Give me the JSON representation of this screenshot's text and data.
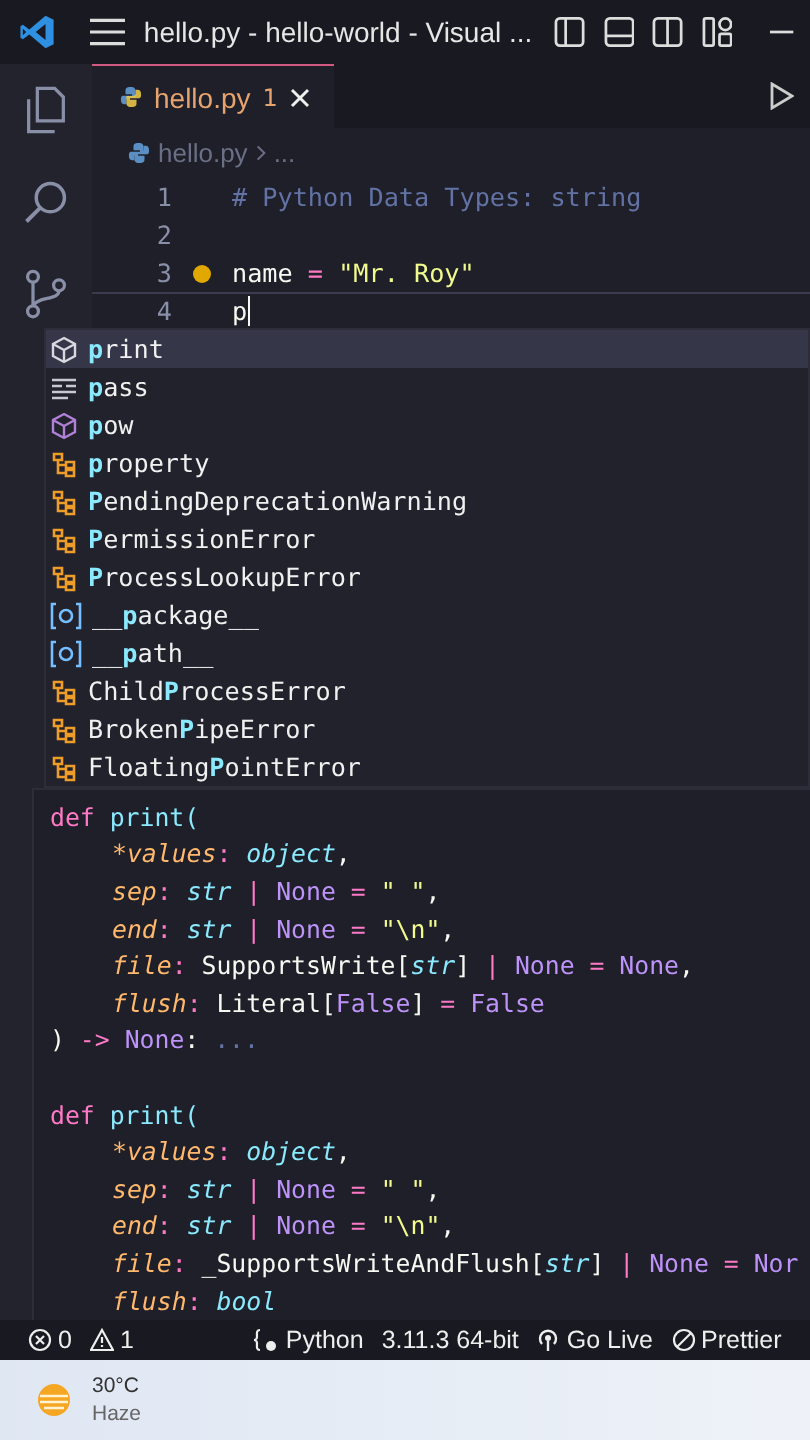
{
  "window": {
    "title": "hello.py - hello-world - Visual ..."
  },
  "tabs": [
    {
      "label": "hello.py",
      "problems": "1",
      "selected": true
    }
  ],
  "breadcrumb": {
    "file": "hello.py",
    "more": "..."
  },
  "editor": {
    "lines": [
      {
        "number": "1",
        "current": false,
        "tokens": [
          {
            "kind": "comment",
            "text": "# Python Data Types: string"
          }
        ]
      },
      {
        "number": "2",
        "current": false
      },
      {
        "number": "3",
        "current": false,
        "lightbulb": true,
        "tokens": [
          {
            "kind": "plain",
            "text": "name "
          },
          {
            "kind": "op",
            "text": "= "
          },
          {
            "kind": "string",
            "text": "\"Mr. Roy\""
          }
        ]
      },
      {
        "number": "4",
        "current": true,
        "tokens": [
          {
            "kind": "plain",
            "text": "p"
          }
        ]
      }
    ]
  },
  "suggestions": [
    {
      "kind": "method",
      "match": "p",
      "rest": "rint",
      "selected": true
    },
    {
      "kind": "keyword",
      "match": "p",
      "rest": "ass",
      "selected": false
    },
    {
      "kind": "function",
      "match": "p",
      "rest": "ow",
      "selected": false
    },
    {
      "kind": "class",
      "match": "p",
      "rest": "roperty",
      "selected": false
    },
    {
      "kind": "class",
      "match": "P",
      "rest": "endingDeprecationWarning",
      "selected": false
    },
    {
      "kind": "class",
      "match": "P",
      "rest": "ermissionError",
      "selected": false
    },
    {
      "kind": "class",
      "match": "P",
      "rest": "rocessLookupError",
      "selected": false
    },
    {
      "kind": "variable",
      "prefix": "__",
      "match": "p",
      "rest": "ackage__",
      "selected": false
    },
    {
      "kind": "variable",
      "prefix": "__",
      "match": "p",
      "rest": "ath__",
      "selected": false
    },
    {
      "kind": "class",
      "prefix": "Child",
      "match": "P",
      "rest": "rocessError",
      "selected": false
    },
    {
      "kind": "class",
      "prefix": "Broken",
      "match": "P",
      "rest": "ipeError",
      "selected": false
    },
    {
      "kind": "class",
      "prefix": "Floating",
      "match": "P",
      "rest": "ointError",
      "selected": false
    }
  ],
  "hover": {
    "lines": [
      {
        "kind": "code",
        "indent": false,
        "tokens": [
          {
            "kind": "keyword",
            "text": "def "
          },
          {
            "kind": "func",
            "text": "print("
          }
        ]
      },
      {
        "kind": "code",
        "indent": true,
        "tokens": [
          {
            "kind": "param",
            "text": "*values"
          },
          {
            "kind": "op",
            "text": ": "
          },
          {
            "kind": "type",
            "text": "object"
          },
          {
            "kind": "plain",
            "text": ","
          }
        ]
      },
      {
        "kind": "code",
        "indent": true,
        "tokens": [
          {
            "kind": "param",
            "text": "sep"
          },
          {
            "kind": "op",
            "text": ": "
          },
          {
            "kind": "type",
            "text": "str "
          },
          {
            "kind": "op",
            "text": "| "
          },
          {
            "kind": "const",
            "text": "None "
          },
          {
            "kind": "op",
            "text": "= "
          },
          {
            "kind": "string",
            "text": "\" \""
          },
          {
            "kind": "plain",
            "text": ","
          }
        ]
      },
      {
        "kind": "code",
        "indent": true,
        "tokens": [
          {
            "kind": "param",
            "text": "end"
          },
          {
            "kind": "op",
            "text": ": "
          },
          {
            "kind": "type",
            "text": "str "
          },
          {
            "kind": "op",
            "text": "| "
          },
          {
            "kind": "const",
            "text": "None "
          },
          {
            "kind": "op",
            "text": "= "
          },
          {
            "kind": "string",
            "text": "\"\\n\""
          },
          {
            "kind": "plain",
            "text": ","
          }
        ]
      },
      {
        "kind": "code",
        "indent": true,
        "tokens": [
          {
            "kind": "param",
            "text": "file"
          },
          {
            "kind": "op",
            "text": ": "
          },
          {
            "kind": "plain",
            "text": "SupportsWrite["
          },
          {
            "kind": "type",
            "text": "str"
          },
          {
            "kind": "plain",
            "text": "] "
          },
          {
            "kind": "op",
            "text": "| "
          },
          {
            "kind": "const",
            "text": "None "
          },
          {
            "kind": "op",
            "text": "= "
          },
          {
            "kind": "const",
            "text": "None"
          },
          {
            "kind": "plain",
            "text": ","
          }
        ]
      },
      {
        "kind": "code",
        "indent": true,
        "tokens": [
          {
            "kind": "param",
            "text": "flush"
          },
          {
            "kind": "op",
            "text": ": "
          },
          {
            "kind": "plain",
            "text": "Literal["
          },
          {
            "kind": "const",
            "text": "False"
          },
          {
            "kind": "plain",
            "text": "] "
          },
          {
            "kind": "op",
            "text": "= "
          },
          {
            "kind": "const",
            "text": "False"
          }
        ]
      },
      {
        "kind": "code",
        "indent": false,
        "tokens": [
          {
            "kind": "plain",
            "text": ") "
          },
          {
            "kind": "op",
            "text": "-> "
          },
          {
            "kind": "const",
            "text": "None"
          },
          {
            "kind": "plain",
            "text": ": "
          },
          {
            "kind": "comment",
            "text": "..."
          }
        ]
      },
      {
        "kind": "blank"
      },
      {
        "kind": "code",
        "indent": false,
        "tokens": [
          {
            "kind": "keyword",
            "text": "def "
          },
          {
            "kind": "func",
            "text": "print("
          }
        ]
      },
      {
        "kind": "code",
        "indent": true,
        "tokens": [
          {
            "kind": "param",
            "text": "*values"
          },
          {
            "kind": "op",
            "text": ": "
          },
          {
            "kind": "type",
            "text": "object"
          },
          {
            "kind": "plain",
            "text": ","
          }
        ]
      },
      {
        "kind": "code",
        "indent": true,
        "tokens": [
          {
            "kind": "param",
            "text": "sep"
          },
          {
            "kind": "op",
            "text": ": "
          },
          {
            "kind": "type",
            "text": "str "
          },
          {
            "kind": "op",
            "text": "| "
          },
          {
            "kind": "const",
            "text": "None "
          },
          {
            "kind": "op",
            "text": "= "
          },
          {
            "kind": "string",
            "text": "\" \""
          },
          {
            "kind": "plain",
            "text": ","
          }
        ]
      },
      {
        "kind": "code",
        "indent": true,
        "tokens": [
          {
            "kind": "param",
            "text": "end"
          },
          {
            "kind": "op",
            "text": ": "
          },
          {
            "kind": "type",
            "text": "str "
          },
          {
            "kind": "op",
            "text": "| "
          },
          {
            "kind": "const",
            "text": "None "
          },
          {
            "kind": "op",
            "text": "= "
          },
          {
            "kind": "string",
            "text": "\"\\n\""
          },
          {
            "kind": "plain",
            "text": ","
          }
        ]
      },
      {
        "kind": "code",
        "indent": true,
        "tokens": [
          {
            "kind": "param",
            "text": "file"
          },
          {
            "kind": "op",
            "text": ": "
          },
          {
            "kind": "plain",
            "text": "_SupportsWriteAndFlush["
          },
          {
            "kind": "type",
            "text": "str"
          },
          {
            "kind": "plain",
            "text": "] "
          },
          {
            "kind": "op",
            "text": "| "
          },
          {
            "kind": "const",
            "text": "None "
          },
          {
            "kind": "op",
            "text": "= "
          },
          {
            "kind": "const",
            "text": "Nor"
          }
        ]
      },
      {
        "kind": "code",
        "indent": true,
        "tokens": [
          {
            "kind": "param",
            "text": "flush"
          },
          {
            "kind": "op",
            "text": ": "
          },
          {
            "kind": "type",
            "text": "bool"
          }
        ]
      }
    ]
  },
  "status_bar": [
    {
      "kind": "errors",
      "text": "0"
    },
    {
      "kind": "warnings",
      "text": "1"
    },
    {
      "kind": "language",
      "text": "Python"
    },
    {
      "kind": "version",
      "text": "3.11.3 64-bit"
    },
    {
      "kind": "live",
      "text": "Go Live"
    },
    {
      "kind": "formatter",
      "text": "Prettier"
    }
  ],
  "taskbar": {
    "temperature": "30°C",
    "condition": "Haze"
  }
}
